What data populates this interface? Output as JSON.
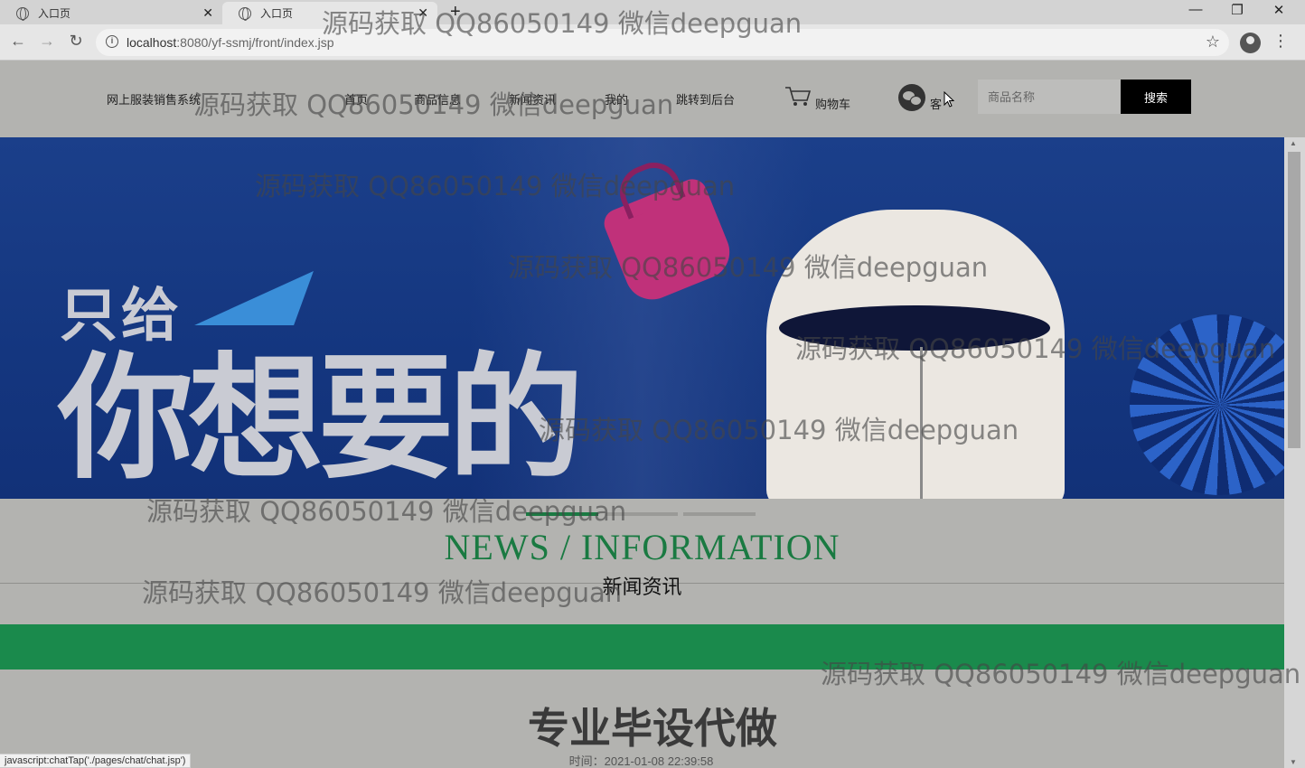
{
  "browser": {
    "tabs": [
      {
        "title": "入口页"
      },
      {
        "title": "入口页"
      }
    ],
    "new_tab_glyph": "+",
    "url_host": "localhost",
    "url_path": ":8080/yf-ssmj/front/index.jsp",
    "window_controls": {
      "minimize": "—",
      "maximize": "❐",
      "close": "✕"
    }
  },
  "site_nav": {
    "brand": "网上服装销售系统",
    "links": [
      "首页",
      "商品信息",
      "新闻资讯",
      "我的",
      "跳转到后台"
    ],
    "cart_label": "购物车",
    "service_label": "客",
    "search_placeholder": "商品名称",
    "search_button": "搜索"
  },
  "banner": {
    "subtitle": "只给",
    "headline": "你想要的"
  },
  "news": {
    "title_en": "NEWS / INFORMATION",
    "title_cn": "新闻资讯",
    "headline": "专业毕设代做",
    "time": "时间：2021-01-08 22:39:58"
  },
  "status_bar": {
    "link": "javascript:chatTap('./pages/chat/chat.jsp')"
  },
  "watermark_text": "源码获取 QQ86050149 微信deepguan",
  "colors": {
    "accent_green": "#1a8a4c",
    "news_green": "#1a7a42",
    "banner_blue": "#1b3f8a",
    "page_bg": "#b3b3b0"
  }
}
